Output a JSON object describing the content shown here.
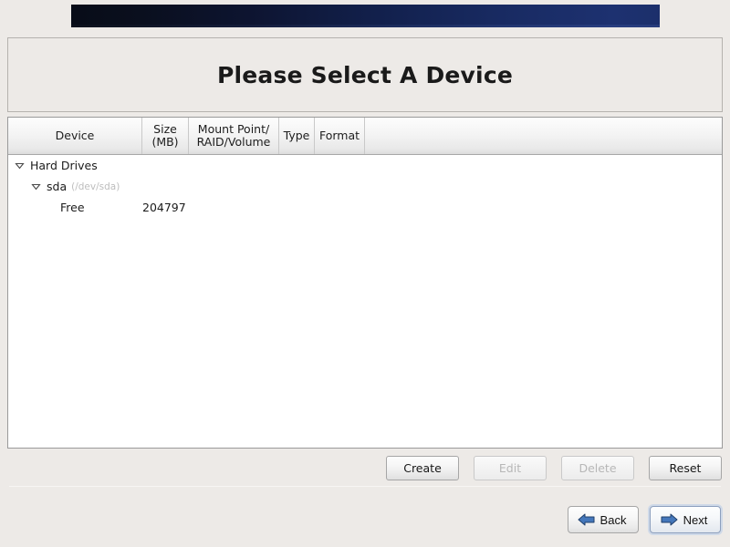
{
  "banner": {
    "gradient_start": "#080c18",
    "gradient_end": "#1d3170"
  },
  "title": {
    "text": "Please Select A Device"
  },
  "table": {
    "columns": [
      {
        "key": "device",
        "label": "Device"
      },
      {
        "key": "size",
        "label": "Size\n(MB)"
      },
      {
        "key": "mount",
        "label": "Mount Point/\nRAID/Volume"
      },
      {
        "key": "type",
        "label": "Type"
      },
      {
        "key": "format",
        "label": "Format"
      }
    ],
    "rows": [
      {
        "name": "Hard Drives",
        "path": "",
        "size": "",
        "mount": "",
        "type": "",
        "format": "",
        "level": 0,
        "expander": "expanded-triangle-icon"
      },
      {
        "name": "sda",
        "path": "(/dev/sda)",
        "size": "",
        "mount": "",
        "type": "",
        "format": "",
        "level": 1,
        "expander": "expanded-triangle-icon"
      },
      {
        "name": "Free",
        "path": "",
        "size": "204797",
        "mount": "",
        "type": "",
        "format": "",
        "level": 2,
        "expander": ""
      }
    ]
  },
  "actions": [
    {
      "label": "Create",
      "enabled": true,
      "name": "create-button"
    },
    {
      "label": "Edit",
      "enabled": false,
      "name": "edit-button"
    },
    {
      "label": "Delete",
      "enabled": false,
      "name": "delete-button"
    },
    {
      "label": "Reset",
      "enabled": true,
      "name": "reset-button"
    }
  ],
  "nav": {
    "back": {
      "label": "Back",
      "icon": "arrow-left-icon",
      "focused": false
    },
    "next": {
      "label": "Next",
      "icon": "arrow-right-icon",
      "focused": true
    },
    "arrow_color": "#4477bb"
  }
}
